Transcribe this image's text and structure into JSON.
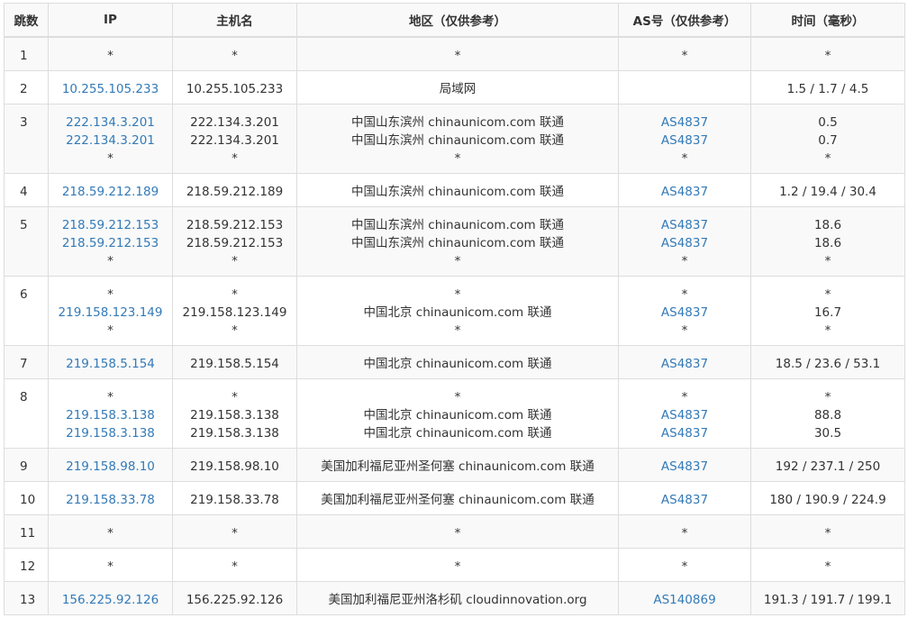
{
  "headers": [
    "跳数",
    "IP",
    "主机名",
    "地区（仅供参考）",
    "AS号（仅供参考）",
    "时间（毫秒）"
  ],
  "rows": [
    {
      "hop": "1",
      "ip": [
        "*"
      ],
      "host": [
        "*"
      ],
      "region": [
        "*"
      ],
      "as": [
        "*"
      ],
      "time": [
        "*"
      ]
    },
    {
      "hop": "2",
      "ip": [
        "10.255.105.233"
      ],
      "host": [
        "10.255.105.233"
      ],
      "region": [
        "局域网"
      ],
      "as": [
        ""
      ],
      "time": [
        "1.5 / 1.7 / 4.5"
      ]
    },
    {
      "hop": "3",
      "ip": [
        "222.134.3.201",
        "222.134.3.201",
        "*"
      ],
      "host": [
        "222.134.3.201",
        "222.134.3.201",
        "*"
      ],
      "region": [
        "中国山东滨州 chinaunicom.com 联通",
        "中国山东滨州 chinaunicom.com 联通",
        "*"
      ],
      "as": [
        "AS4837",
        "AS4837",
        "*"
      ],
      "time": [
        "0.5",
        "0.7",
        "*"
      ]
    },
    {
      "hop": "4",
      "ip": [
        "218.59.212.189"
      ],
      "host": [
        "218.59.212.189"
      ],
      "region": [
        "中国山东滨州 chinaunicom.com 联通"
      ],
      "as": [
        "AS4837"
      ],
      "time": [
        "1.2 / 19.4 / 30.4"
      ]
    },
    {
      "hop": "5",
      "ip": [
        "218.59.212.153",
        "218.59.212.153",
        "*"
      ],
      "host": [
        "218.59.212.153",
        "218.59.212.153",
        "*"
      ],
      "region": [
        "中国山东滨州 chinaunicom.com 联通",
        "中国山东滨州 chinaunicom.com 联通",
        "*"
      ],
      "as": [
        "AS4837",
        "AS4837",
        "*"
      ],
      "time": [
        "18.6",
        "18.6",
        "*"
      ]
    },
    {
      "hop": "6",
      "ip": [
        "*",
        "219.158.123.149",
        "*"
      ],
      "host": [
        "*",
        "219.158.123.149",
        "*"
      ],
      "region": [
        "*",
        "中国北京 chinaunicom.com 联通",
        "*"
      ],
      "as": [
        "*",
        "AS4837",
        "*"
      ],
      "time": [
        "*",
        "16.7",
        "*"
      ]
    },
    {
      "hop": "7",
      "ip": [
        "219.158.5.154"
      ],
      "host": [
        "219.158.5.154"
      ],
      "region": [
        "中国北京 chinaunicom.com 联通"
      ],
      "as": [
        "AS4837"
      ],
      "time": [
        "18.5 / 23.6 / 53.1"
      ]
    },
    {
      "hop": "8",
      "ip": [
        "*",
        "219.158.3.138",
        "219.158.3.138"
      ],
      "host": [
        "*",
        "219.158.3.138",
        "219.158.3.138"
      ],
      "region": [
        "*",
        "中国北京 chinaunicom.com 联通",
        "中国北京 chinaunicom.com 联通"
      ],
      "as": [
        "*",
        "AS4837",
        "AS4837"
      ],
      "time": [
        "*",
        "88.8",
        "30.5"
      ]
    },
    {
      "hop": "9",
      "ip": [
        "219.158.98.10"
      ],
      "host": [
        "219.158.98.10"
      ],
      "region": [
        "美国加利福尼亚州圣何塞 chinaunicom.com 联通"
      ],
      "as": [
        "AS4837"
      ],
      "time": [
        "192 / 237.1 / 250"
      ]
    },
    {
      "hop": "10",
      "ip": [
        "219.158.33.78"
      ],
      "host": [
        "219.158.33.78"
      ],
      "region": [
        "美国加利福尼亚州圣何塞 chinaunicom.com 联通"
      ],
      "as": [
        "AS4837"
      ],
      "time": [
        "180 / 190.9 / 224.9"
      ]
    },
    {
      "hop": "11",
      "ip": [
        "*"
      ],
      "host": [
        "*"
      ],
      "region": [
        "*"
      ],
      "as": [
        "*"
      ],
      "time": [
        "*"
      ]
    },
    {
      "hop": "12",
      "ip": [
        "*"
      ],
      "host": [
        "*"
      ],
      "region": [
        "*"
      ],
      "as": [
        "*"
      ],
      "time": [
        "*"
      ]
    },
    {
      "hop": "13",
      "ip": [
        "156.225.92.126"
      ],
      "host": [
        "156.225.92.126"
      ],
      "region": [
        "美国加利福尼亚州洛杉矶 cloudinnovation.org"
      ],
      "as": [
        "AS140869"
      ],
      "time": [
        "191.3 / 191.7 / 199.1"
      ]
    }
  ],
  "colors": {
    "link": "#337ab7",
    "text": "#333333",
    "stripe": "#f9f9f9",
    "border": "#dddddd"
  }
}
